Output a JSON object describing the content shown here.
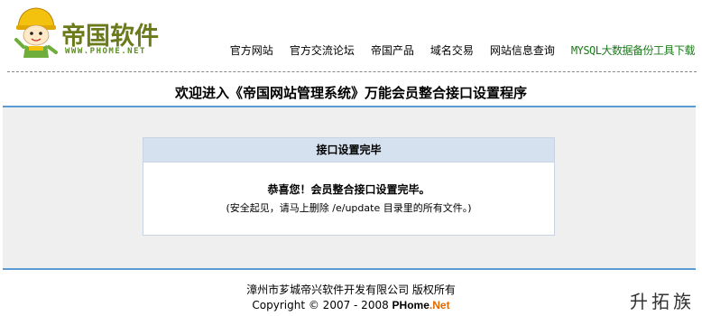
{
  "header": {
    "logo_text": "帝国软件",
    "logo_subtext": "WWW.PHOME.NET",
    "nav": [
      {
        "label": "官方网站"
      },
      {
        "label": "官方交流论坛"
      },
      {
        "label": "帝国产品"
      },
      {
        "label": "域名交易"
      },
      {
        "label": "网站信息查询"
      },
      {
        "label": "MYSQL大数据备份工具下载"
      }
    ]
  },
  "page_title": "欢迎进入《帝国网站管理系统》万能会员整合接口设置程序",
  "panel": {
    "heading": "接口设置完毕",
    "message": "恭喜您！会员整合接口设置完毕。",
    "note": "(安全起见，请马上删除 /e/update 目录里的所有文件。)"
  },
  "footer": {
    "company": "漳州市芗城帝兴软件开发有限公司 版权所有",
    "copyright_prefix": "Copyright © 2007 - 2008 ",
    "brand_main": "PHome",
    "brand_net": ".Net"
  },
  "corner_text": "升拓族",
  "colors": {
    "accent_blue": "#5b9bd5",
    "panel_head_bg": "#d5e1ef",
    "band_bg": "#efefef",
    "nav_highlight": "#1a7a1a",
    "logo_olive": "#6b7a1a",
    "net_orange": "#e06b00"
  }
}
